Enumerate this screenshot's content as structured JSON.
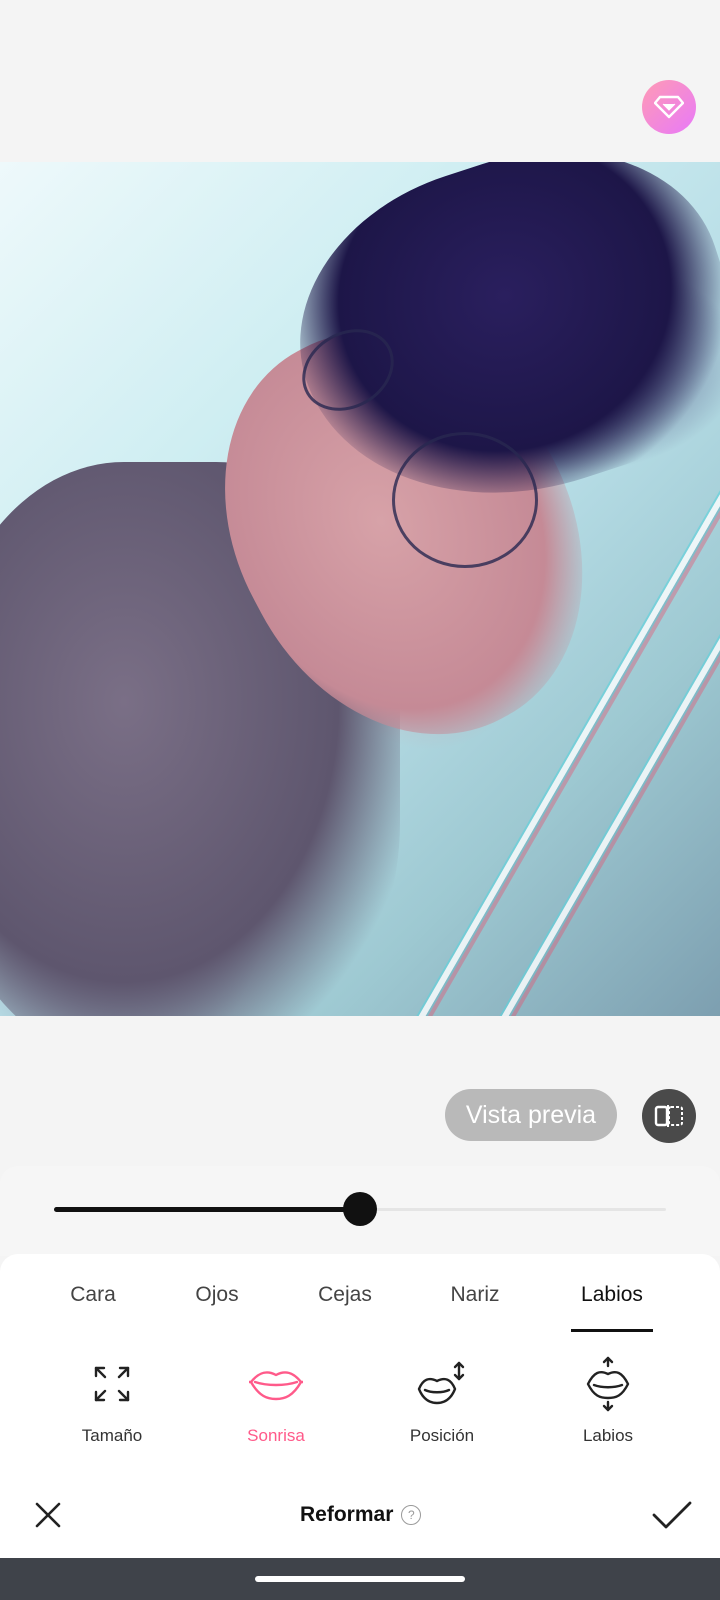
{
  "premium": {
    "icon": "diamond-icon"
  },
  "photo": {
    "description_icon": "photo-preview"
  },
  "preview": {
    "label": "Vista previa",
    "compare_icon": "compare-icon"
  },
  "slider": {
    "value": 0.5
  },
  "tabs": [
    {
      "label": "Cara",
      "active": false
    },
    {
      "label": "Ojos",
      "active": false
    },
    {
      "label": "Cejas",
      "active": false
    },
    {
      "label": "Nariz",
      "active": false
    },
    {
      "label": "Labios",
      "active": true
    }
  ],
  "tools": [
    {
      "label": "Tamaño",
      "icon": "expand-arrows-icon",
      "active": false
    },
    {
      "label": "Sonrisa",
      "icon": "smile-lips-icon",
      "active": true
    },
    {
      "label": "Posición",
      "icon": "lips-position-icon",
      "active": false
    },
    {
      "label": "Labios",
      "icon": "lips-updown-icon",
      "active": false
    }
  ],
  "footer": {
    "title": "Reformar",
    "help": "?"
  },
  "colors": {
    "accent": "#ff5a8a",
    "dark": "#111111",
    "nav": "#3f434a"
  }
}
